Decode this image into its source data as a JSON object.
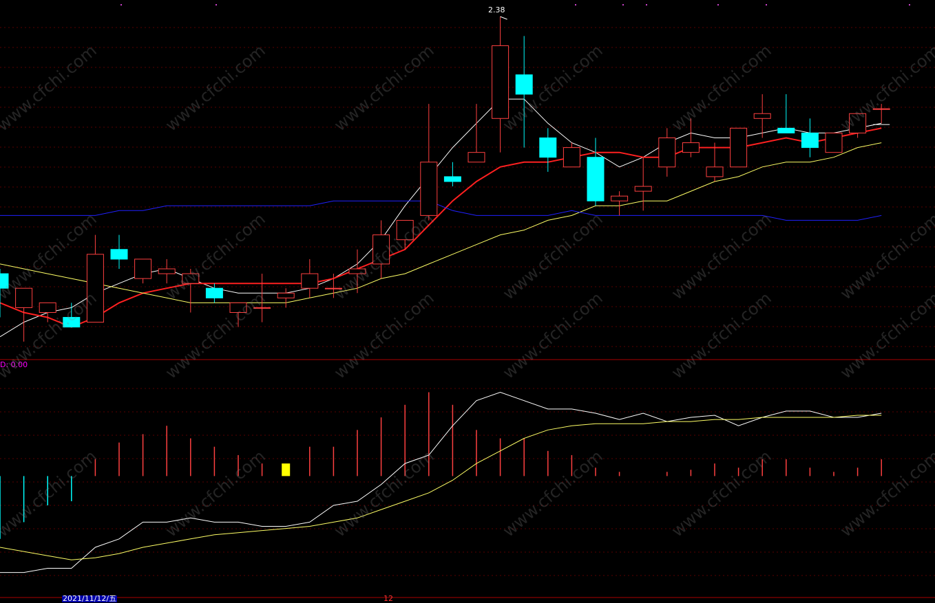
{
  "chart_data": [
    {
      "type": "candlestick",
      "series": [
        {
          "name": "",
          "kind": "candles",
          "values": [
            {
              "o": 1.85,
              "h": 1.86,
              "l": 1.76,
              "c": 1.82
            },
            {
              "o": 1.78,
              "h": 1.8,
              "l": 1.71,
              "c": 1.82
            },
            {
              "o": 1.77,
              "h": 1.79,
              "l": 1.75,
              "c": 1.79
            },
            {
              "o": 1.76,
              "h": 1.79,
              "l": 1.74,
              "c": 1.74
            },
            {
              "o": 1.75,
              "h": 1.93,
              "l": 1.75,
              "c": 1.89
            },
            {
              "o": 1.9,
              "h": 1.93,
              "l": 1.86,
              "c": 1.88
            },
            {
              "o": 1.84,
              "h": 1.88,
              "l": 1.83,
              "c": 1.88
            },
            {
              "o": 1.85,
              "h": 1.88,
              "l": 1.83,
              "c": 1.86
            },
            {
              "o": 1.83,
              "h": 1.86,
              "l": 1.77,
              "c": 1.85
            },
            {
              "o": 1.82,
              "h": 1.83,
              "l": 1.79,
              "c": 1.8
            },
            {
              "o": 1.77,
              "h": 1.79,
              "l": 1.74,
              "c": 1.79
            },
            {
              "o": 1.78,
              "h": 1.85,
              "l": 1.75,
              "c": 1.78
            },
            {
              "o": 1.8,
              "h": 1.82,
              "l": 1.78,
              "c": 1.81
            },
            {
              "o": 1.82,
              "h": 1.88,
              "l": 1.8,
              "c": 1.85
            },
            {
              "o": 1.82,
              "h": 1.85,
              "l": 1.8,
              "c": 1.82
            },
            {
              "o": 1.85,
              "h": 1.9,
              "l": 1.81,
              "c": 1.86
            },
            {
              "o": 1.87,
              "h": 1.96,
              "l": 1.84,
              "c": 1.93
            },
            {
              "o": 1.92,
              "h": 1.95,
              "l": 1.9,
              "c": 1.96
            },
            {
              "o": 1.97,
              "h": 2.2,
              "l": 1.96,
              "c": 2.08
            },
            {
              "o": 2.05,
              "h": 2.08,
              "l": 2.03,
              "c": 2.04
            },
            {
              "o": 2.08,
              "h": 2.2,
              "l": 2.08,
              "c": 2.1
            },
            {
              "o": 2.17,
              "h": 2.38,
              "l": 2.1,
              "c": 2.32
            },
            {
              "o": 2.26,
              "h": 2.34,
              "l": 2.11,
              "c": 2.22
            },
            {
              "o": 2.13,
              "h": 2.15,
              "l": 2.06,
              "c": 2.09
            },
            {
              "o": 2.07,
              "h": 2.12,
              "l": 2.07,
              "c": 2.11
            },
            {
              "o": 2.09,
              "h": 2.13,
              "l": 1.99,
              "c": 2.0
            },
            {
              "o": 2.0,
              "h": 2.02,
              "l": 1.97,
              "c": 2.01
            },
            {
              "o": 2.02,
              "h": 2.09,
              "l": 1.98,
              "c": 2.03
            },
            {
              "o": 2.07,
              "h": 2.15,
              "l": 2.05,
              "c": 2.13
            },
            {
              "o": 2.1,
              "h": 2.17,
              "l": 2.09,
              "c": 2.12
            },
            {
              "o": 2.05,
              "h": 2.12,
              "l": 2.04,
              "c": 2.07
            },
            {
              "o": 2.07,
              "h": 2.15,
              "l": 2.07,
              "c": 2.15
            },
            {
              "o": 2.17,
              "h": 2.22,
              "l": 2.13,
              "c": 2.18
            },
            {
              "o": 2.15,
              "h": 2.22,
              "l": 2.14,
              "c": 2.14
            },
            {
              "o": 2.14,
              "h": 2.17,
              "l": 2.09,
              "c": 2.11
            },
            {
              "o": 2.1,
              "h": 2.14,
              "l": 2.1,
              "c": 2.14
            },
            {
              "o": 2.14,
              "h": 2.18,
              "l": 2.13,
              "c": 2.18
            },
            {
              "o": 2.19,
              "h": 2.2,
              "l": 2.16,
              "c": 2.19
            }
          ]
        },
        {
          "name": "",
          "kind": "line",
          "color": "#ffffff",
          "values": [
            1.72,
            1.75,
            1.77,
            1.78,
            1.81,
            1.83,
            1.85,
            1.86,
            1.84,
            1.82,
            1.81,
            1.81,
            1.81,
            1.82,
            1.84,
            1.87,
            1.92,
            1.99,
            2.05,
            2.11,
            2.16,
            2.21,
            2.21,
            2.16,
            2.12,
            2.1,
            2.07,
            2.09,
            2.12,
            2.14,
            2.13,
            2.13,
            2.14,
            2.15,
            2.14,
            2.14,
            2.15,
            2.16
          ]
        },
        {
          "name": "",
          "kind": "line",
          "color": "#ff2020",
          "values": [
            1.79,
            1.77,
            1.76,
            1.74,
            1.76,
            1.79,
            1.81,
            1.82,
            1.83,
            1.83,
            1.83,
            1.83,
            1.83,
            1.83,
            1.84,
            1.86,
            1.88,
            1.9,
            1.95,
            2.0,
            2.04,
            2.07,
            2.08,
            2.08,
            2.09,
            2.1,
            2.1,
            2.09,
            2.09,
            2.11,
            2.11,
            2.11,
            2.12,
            2.13,
            2.12,
            2.13,
            2.14,
            2.15
          ]
        },
        {
          "name": "",
          "kind": "line",
          "color": "#ffff66",
          "values": [
            1.87,
            1.86,
            1.85,
            1.84,
            1.83,
            1.82,
            1.81,
            1.8,
            1.79,
            1.79,
            1.79,
            1.79,
            1.79,
            1.8,
            1.81,
            1.82,
            1.84,
            1.85,
            1.87,
            1.89,
            1.91,
            1.93,
            1.94,
            1.96,
            1.97,
            1.99,
            1.99,
            2.0,
            2.0,
            2.02,
            2.04,
            2.05,
            2.07,
            2.08,
            2.08,
            2.09,
            2.11,
            2.12
          ]
        },
        {
          "name": "",
          "kind": "line",
          "color": "#2020ff",
          "values": [
            1.97,
            1.97,
            1.97,
            1.97,
            1.97,
            1.98,
            1.98,
            1.99,
            1.99,
            1.99,
            1.99,
            1.99,
            1.99,
            1.99,
            2.0,
            2.0,
            2.0,
            2.0,
            2.0,
            1.98,
            1.97,
            1.97,
            1.97,
            1.97,
            1.98,
            1.97,
            1.97,
            1.97,
            1.97,
            1.97,
            1.97,
            1.97,
            1.97,
            1.96,
            1.96,
            1.96,
            1.96,
            1.97
          ]
        }
      ],
      "annotations": [
        {
          "label": "2.38"
        }
      ],
      "grid": true,
      "ylim": [
        1.68,
        2.4
      ]
    },
    {
      "type": "bar",
      "label": "D: 0.00",
      "series": [
        {
          "name": "",
          "kind": "histogram",
          "values": [
            -0.03,
            -0.022,
            -0.014,
            -0.012,
            0.008,
            0.016,
            0.02,
            0.024,
            0.018,
            0.014,
            0.01,
            0.006,
            0.006,
            0.014,
            0.014,
            0.022,
            0.028,
            0.034,
            0.04,
            0.034,
            0.022,
            0.018,
            0.018,
            0.012,
            0.01,
            0.004,
            0.002,
            0.0,
            0.002,
            0.003,
            0.006,
            0.004,
            0.008,
            0.008,
            0.004,
            0.002,
            0.004,
            0.008
          ]
        },
        {
          "name": "",
          "kind": "line",
          "color": "#ffffff",
          "values": [
            -0.046,
            -0.046,
            -0.044,
            -0.044,
            -0.034,
            -0.03,
            -0.022,
            -0.022,
            -0.02,
            -0.022,
            -0.022,
            -0.024,
            -0.024,
            -0.022,
            -0.014,
            -0.012,
            -0.004,
            0.006,
            0.01,
            0.024,
            0.036,
            0.04,
            0.036,
            0.032,
            0.032,
            0.03,
            0.027,
            0.03,
            0.026,
            0.028,
            0.029,
            0.024,
            0.028,
            0.031,
            0.031,
            0.028,
            0.028,
            0.03
          ]
        },
        {
          "name": "",
          "kind": "line",
          "color": "#ffff66",
          "values": [
            -0.034,
            -0.036,
            -0.038,
            -0.04,
            -0.039,
            -0.037,
            -0.034,
            -0.032,
            -0.03,
            -0.028,
            -0.027,
            -0.026,
            -0.025,
            -0.024,
            -0.022,
            -0.02,
            -0.016,
            -0.012,
            -0.008,
            -0.002,
            0.006,
            0.012,
            0.018,
            0.022,
            0.024,
            0.025,
            0.025,
            0.025,
            0.026,
            0.026,
            0.027,
            0.027,
            0.028,
            0.028,
            0.028,
            0.028,
            0.029,
            0.029
          ]
        }
      ],
      "grid": true,
      "ylim": [
        -0.055,
        0.05
      ]
    }
  ],
  "x_labels": {
    "date": "2021/11/12/五",
    "month": "12"
  },
  "watermark": "www.cfchi.com"
}
